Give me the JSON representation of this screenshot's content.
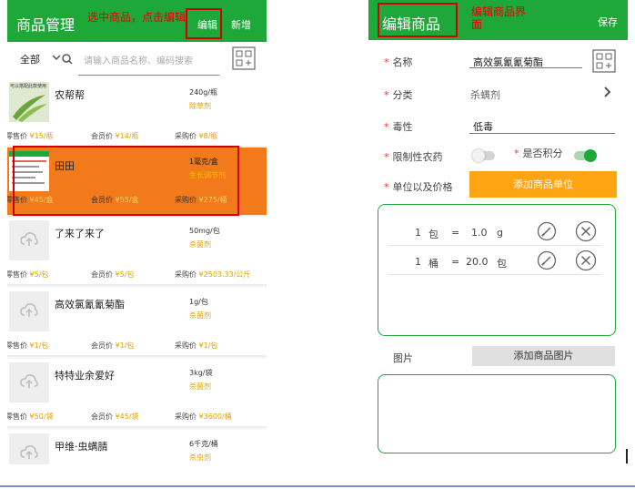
{
  "left": {
    "title": "商品管理",
    "annotation": "选中商品，点击编辑",
    "edit_label": "编辑",
    "add_label": "新增",
    "filter_label": "全部",
    "search_placeholder": "请输入商品名称、编码搜索",
    "retail_label": "零售价",
    "member_label": "会员价",
    "purchase_label": "采购价",
    "thumb_caption": "可以搭配此款使用",
    "items": [
      {
        "name": "农帮帮",
        "spec": "240g/瓶",
        "category": "除草剂",
        "retail": "¥15/瓶",
        "member": "¥14/瓶",
        "purchase": "¥8/瓶"
      },
      {
        "name": "田田",
        "spec": "1毫克/盒",
        "category": "生长调节剂",
        "retail": "¥45/盒",
        "member": "¥55/盒",
        "purchase": "¥275/桶"
      },
      {
        "name": "了来了来了",
        "spec": "50mg/包",
        "category": "杀菌剂",
        "retail": "¥5/包",
        "member": "¥5/包",
        "purchase": "¥2503.33/公斤"
      },
      {
        "name": "高效氯氰氰菊酯",
        "spec": "1g/包",
        "category": "杀菌剂",
        "retail": "¥1/包",
        "member": "¥1/包",
        "purchase": "¥1/包"
      },
      {
        "name": "特特业余爱好",
        "spec": "3kg/袋",
        "category": "杀菌剂",
        "retail": "¥50/袋",
        "member": "¥45/袋",
        "purchase": "¥3600/桶"
      },
      {
        "name": "甲维·虫螨腈",
        "spec": "6千克/桶",
        "category": "杀虫剂",
        "retail": "",
        "member": "",
        "purchase": ""
      }
    ]
  },
  "right": {
    "title": "编辑商品",
    "annotation_line1": "编辑商品界",
    "annotation_line2": "面",
    "save_label": "保存",
    "name_label": "名称",
    "name_value": "高效氯氰氰菊酯",
    "category_label": "分类",
    "category_value": "杀螨剂",
    "toxicity_label": "毒性",
    "toxicity_value": "低毒",
    "restricted_label": "限制性农药",
    "restricted_on": false,
    "points_label": "是否积分",
    "points_on": true,
    "unit_price_label": "单位以及价格",
    "add_unit_label": "添加商品单位",
    "units": [
      {
        "qty": "1",
        "unit": "包",
        "eq": "=",
        "amount": "1.0",
        "base": "g"
      },
      {
        "qty": "1",
        "unit": "桶",
        "eq": "=",
        "amount": "20.0",
        "base": "包"
      }
    ],
    "image_label": "图片",
    "add_image_label": "添加商品图片"
  },
  "colors": {
    "green": "#1fa83a",
    "orange": "#f27a1a",
    "accent": "#ffa514",
    "red": "#d20000"
  }
}
